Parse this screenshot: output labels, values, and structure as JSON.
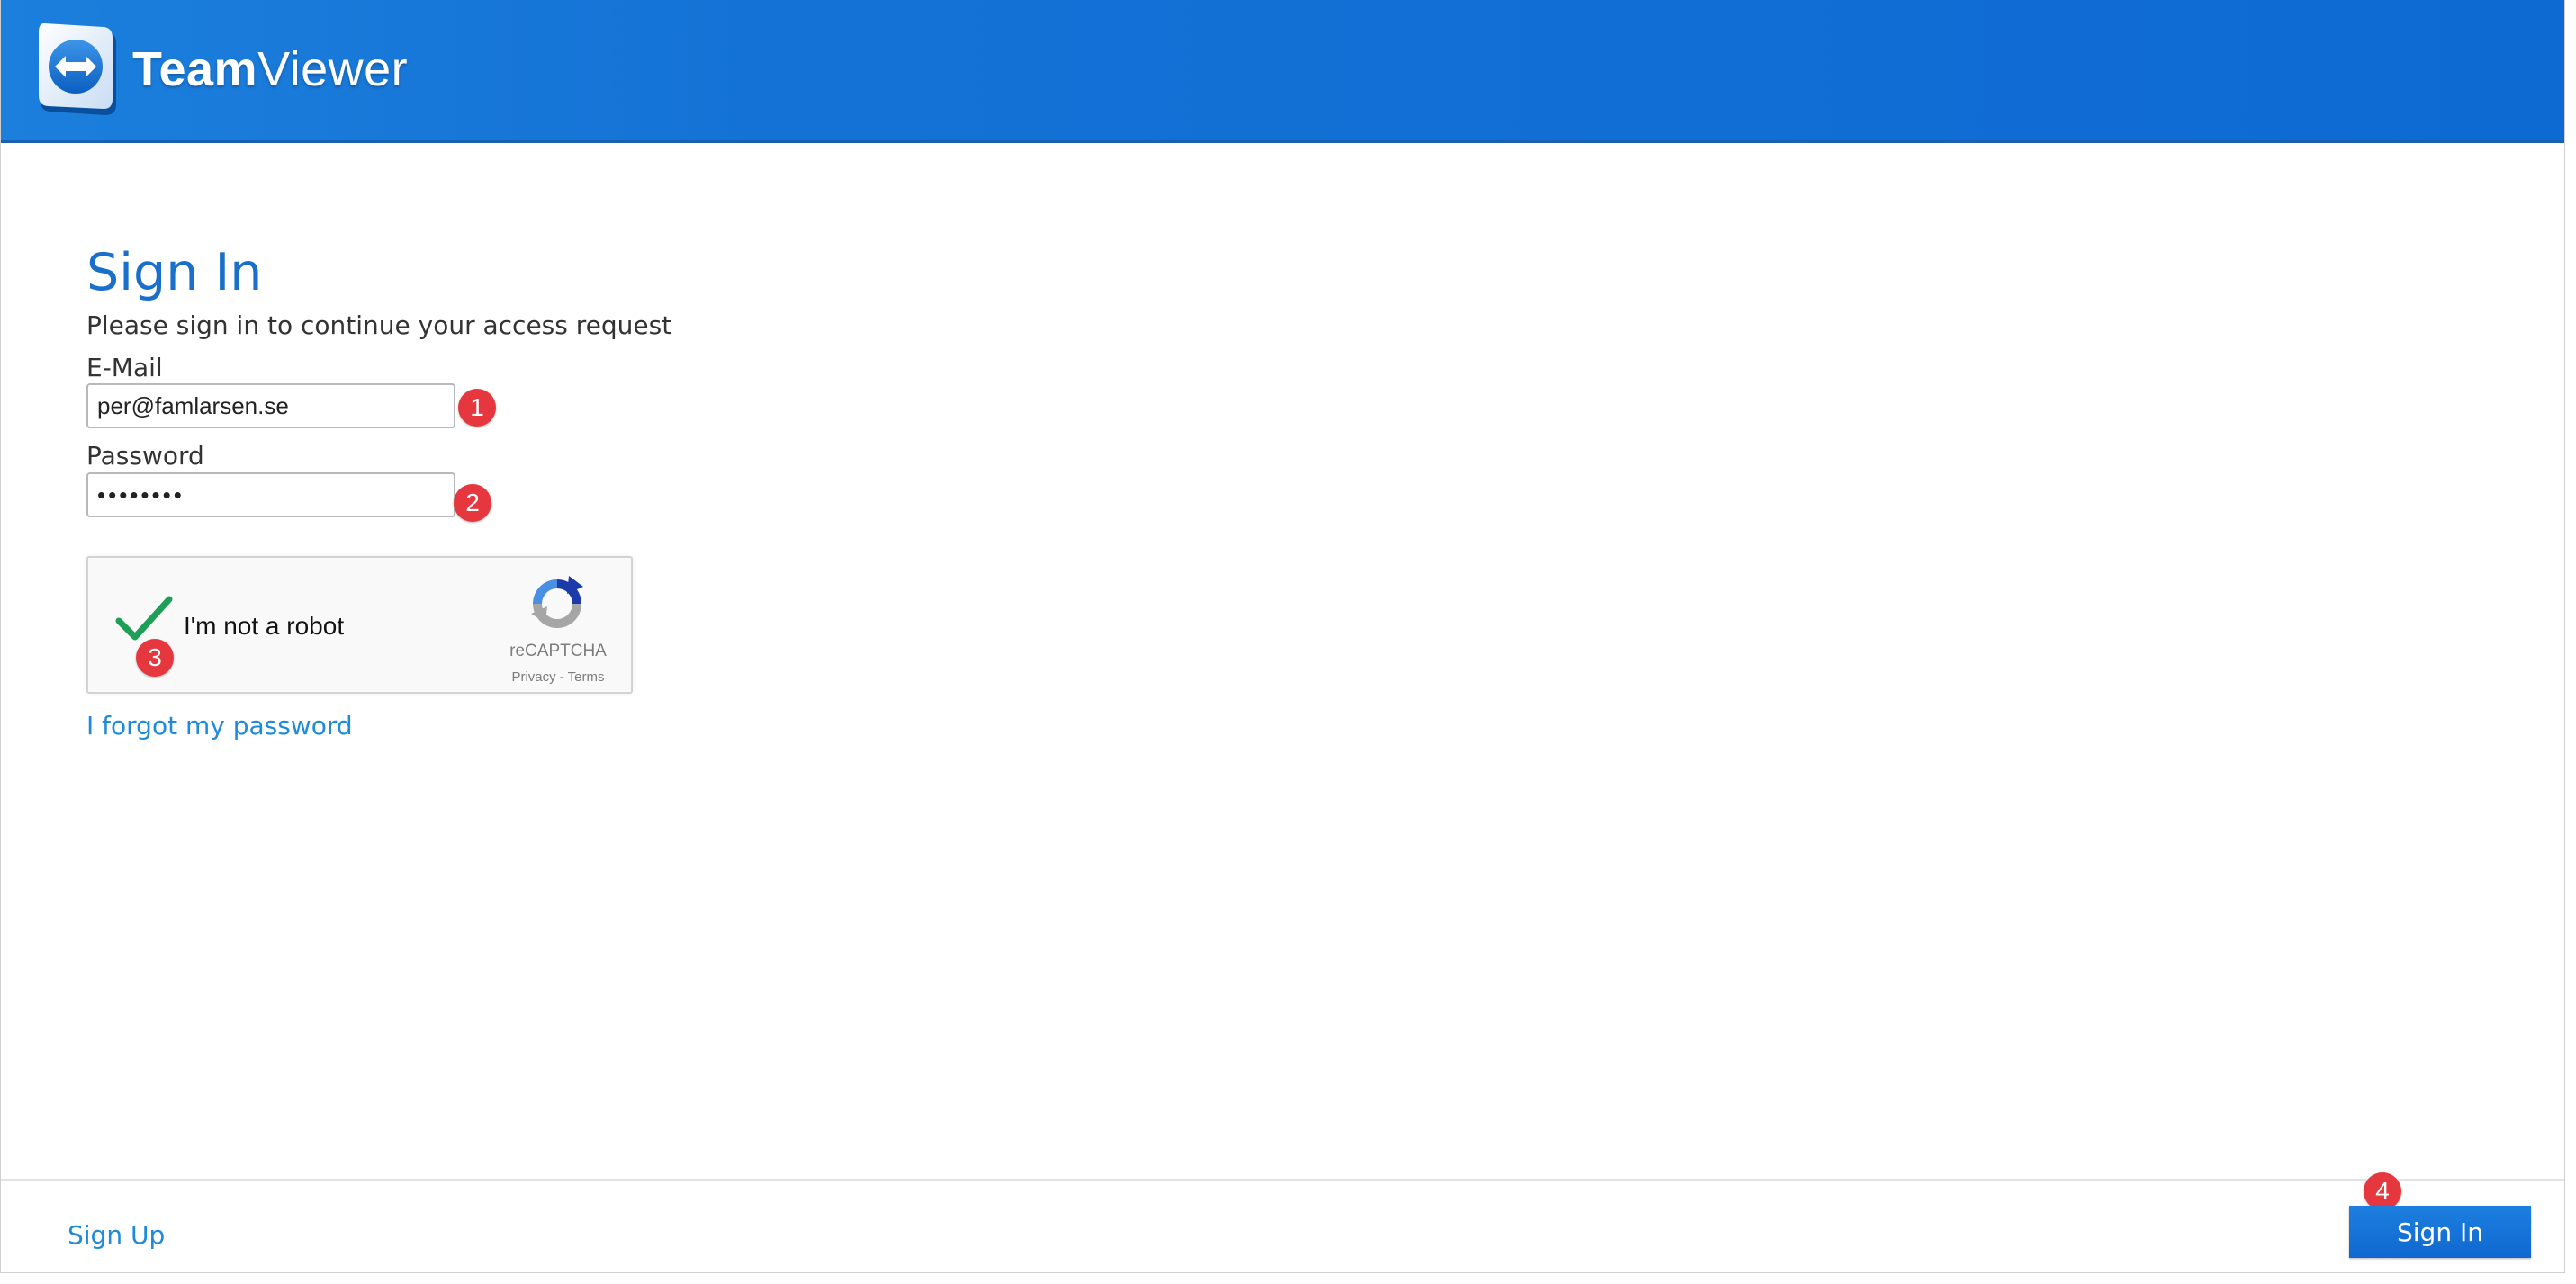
{
  "header": {
    "brand_team": "Team",
    "brand_viewer": "Viewer"
  },
  "form": {
    "title": "Sign In",
    "subtitle": "Please sign in to continue your access request",
    "email_label": "E-Mail",
    "email_value": "per@famlarsen.se",
    "password_label": "Password",
    "password_value": "••••••••",
    "forgot_link": "I forgot my password"
  },
  "captcha": {
    "label": "I'm not a robot",
    "brand": "reCAPTCHA",
    "links": "Privacy - Terms",
    "checked": true
  },
  "footer": {
    "signup_link": "Sign Up",
    "signin_button": "Sign In"
  },
  "badges": {
    "email": "1",
    "password": "2",
    "captcha": "3",
    "signin": "4"
  },
  "colors": {
    "header_blue": "#0e6ad3",
    "title_blue": "#1a6fcb",
    "link_blue": "#1f8ad8",
    "badge_red": "#e6373f",
    "check_green": "#1e9e57"
  }
}
